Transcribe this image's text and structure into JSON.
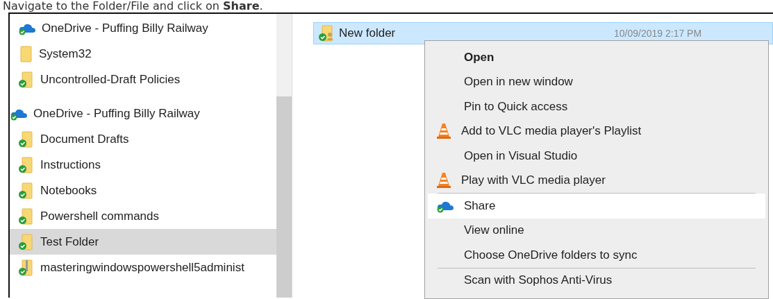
{
  "instruction": "Navigate to the Folder/File and click on **Share**.",
  "nav": {
    "earlier_items": [
      {
        "label": "OneDrive - Puffing Billy Railway",
        "kind": "cloud",
        "selected": false
      },
      {
        "label": "System32",
        "kind": "folder",
        "selected": false
      },
      {
        "label": "Uncontrolled-Draft Policies",
        "kind": "synced-folder",
        "selected": false
      }
    ],
    "items": [
      {
        "label": "OneDrive - Puffing Billy Railway",
        "kind": "cloud",
        "selected": false,
        "children": [
          {
            "label": "Document Drafts",
            "kind": "synced-folder",
            "selected": false
          },
          {
            "label": "Instructions",
            "kind": "synced-folder",
            "selected": false
          },
          {
            "label": "Notebooks",
            "kind": "synced-folder",
            "selected": false
          },
          {
            "label": "Powershell commands",
            "kind": "synced-folder",
            "selected": false
          },
          {
            "label": "Test Folder",
            "kind": "synced-folder",
            "selected": true
          },
          {
            "label": "masteringwindowspowershell5administ",
            "kind": "synced-zip",
            "selected": false
          }
        ]
      }
    ]
  },
  "files": [
    {
      "name": "New folder",
      "date": "10/09/2019 2:17 PM",
      "kind": "shared-folder",
      "selected": true
    }
  ],
  "context_menu": [
    {
      "kind": "plain",
      "label": "Open",
      "default": true,
      "selected": false
    },
    {
      "kind": "plain",
      "label": "Open in new window",
      "default": false,
      "selected": false
    },
    {
      "kind": "plain",
      "label": "Pin to Quick access",
      "default": false,
      "selected": false
    },
    {
      "kind": "vlc",
      "label": "Add to VLC media player's Playlist",
      "default": false,
      "selected": false
    },
    {
      "kind": "plain",
      "label": "Open in Visual Studio",
      "default": false,
      "selected": false
    },
    {
      "kind": "vlc",
      "label": "Play with VLC media player",
      "default": false,
      "selected": false
    },
    {
      "kind": "separator"
    },
    {
      "kind": "cloud",
      "label": "Share",
      "default": false,
      "selected": true
    },
    {
      "kind": "plain",
      "label": "View online",
      "default": false,
      "selected": false
    },
    {
      "kind": "plain",
      "label": "Choose OneDrive folders to sync",
      "default": false,
      "selected": false
    },
    {
      "kind": "separator"
    },
    {
      "kind": "plain",
      "label": "Scan with Sophos Anti-Virus",
      "default": false,
      "selected": false
    }
  ]
}
